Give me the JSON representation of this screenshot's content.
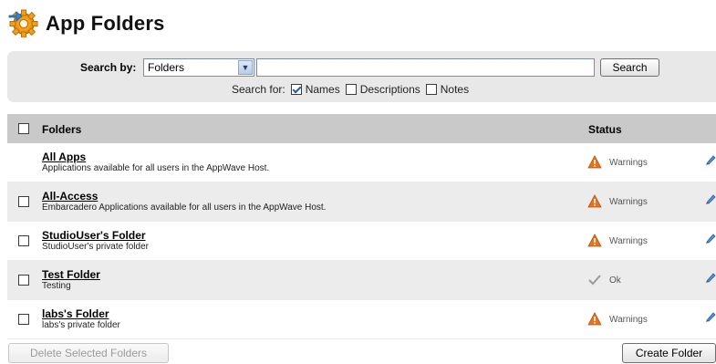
{
  "page": {
    "title": "App Folders",
    "icon": "app-folders-icon"
  },
  "search": {
    "label": "Search by:",
    "select_value": "Folders",
    "input_value": "",
    "button_label": "Search",
    "for_label": "Search for:",
    "options": [
      {
        "label": "Names",
        "checked": true
      },
      {
        "label": "Descriptions",
        "checked": false
      },
      {
        "label": "Notes",
        "checked": false
      }
    ]
  },
  "table": {
    "headers": {
      "folders": "Folders",
      "status": "Status"
    },
    "rows": [
      {
        "name": "All Apps",
        "description": "Applications available for all users in the AppWave Host.",
        "status": "Warnings",
        "status_icon": "warning-icon",
        "has_checkbox": false
      },
      {
        "name": "All-Access",
        "description": "Embarcadero Applications available for all users in the AppWave Host.",
        "status": "Warnings",
        "status_icon": "warning-icon",
        "has_checkbox": true
      },
      {
        "name": "StudioUser's Folder",
        "description": "StudioUser's private folder",
        "status": "Warnings",
        "status_icon": "warning-icon",
        "has_checkbox": true
      },
      {
        "name": "Test Folder",
        "description": "Testing",
        "status": "Ok",
        "status_icon": "check-icon",
        "has_checkbox": true
      },
      {
        "name": "labs's Folder",
        "description": "labs's private folder",
        "status": "Warnings",
        "status_icon": "warning-icon",
        "has_checkbox": true
      }
    ]
  },
  "buttons": {
    "delete": "Delete Selected Folders",
    "create": "Create Folder"
  },
  "colors": {
    "search_bg": "#e8e8e8",
    "header_bg": "#c9c9c9",
    "warning": "#e8731c",
    "alt_row": "#ececec"
  }
}
